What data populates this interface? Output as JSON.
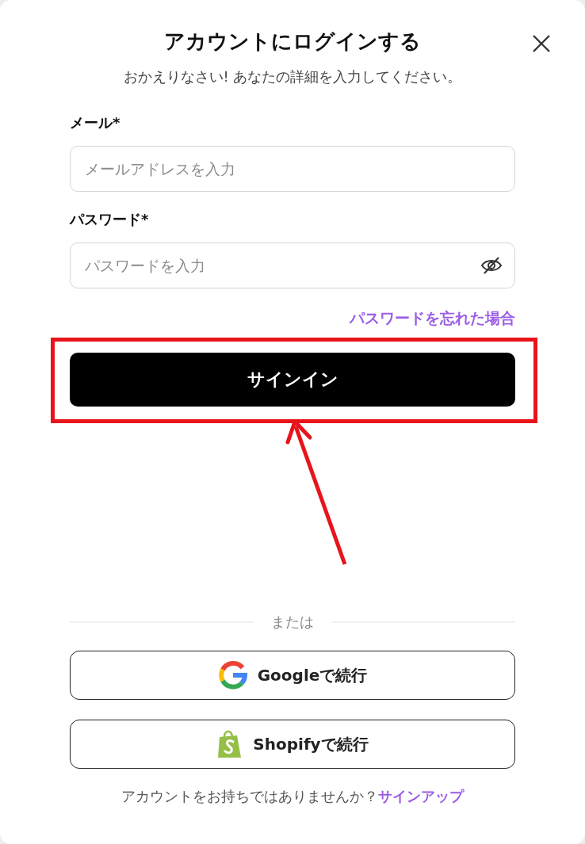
{
  "dialog": {
    "title": "アカウントにログインする",
    "subtitle": "おかえりなさい! あなたの詳細を入力してください。"
  },
  "fields": [
    {
      "kind": "email",
      "label": "メール*",
      "placeholder": "メールアドレスを入力"
    },
    {
      "kind": "password",
      "label": "パスワード*",
      "placeholder": "パスワードを入力"
    }
  ],
  "forgot_link": "パスワードを忘れた場合",
  "sign_in_button": "サインイン",
  "divider": "または",
  "social_buttons": [
    {
      "kind": "google",
      "label": "Googleで続行"
    },
    {
      "kind": "shopify",
      "label": "Shopifyで続行"
    }
  ],
  "footer": {
    "text": "アカウントをお持ちではありませんか？",
    "link": "サインアップ"
  }
}
